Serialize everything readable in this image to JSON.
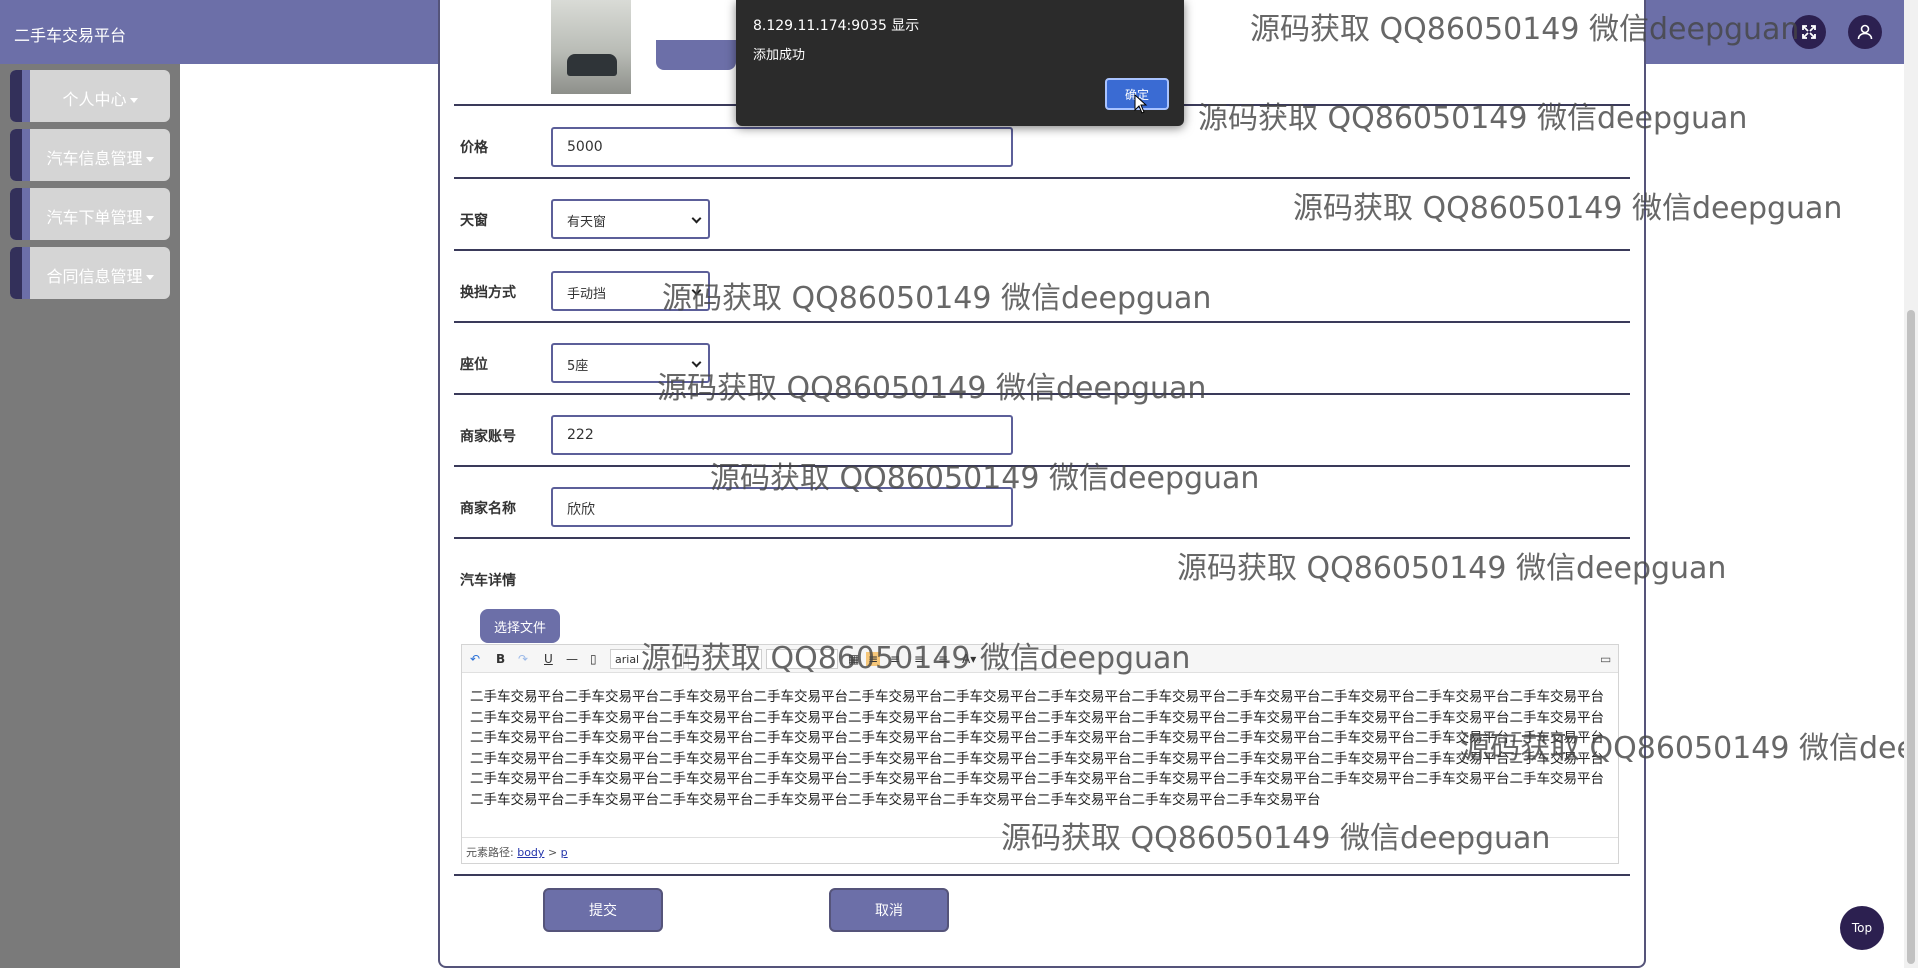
{
  "app": {
    "title": "二手车交易平台"
  },
  "header": {
    "fullscreen_icon": "expand-icon",
    "user_icon": "user-icon"
  },
  "sidebar": {
    "items": [
      {
        "label": "个人中心"
      },
      {
        "label": "汽车信息管理"
      },
      {
        "label": "汽车下单管理"
      },
      {
        "label": "合同信息管理"
      }
    ]
  },
  "form": {
    "price": {
      "label": "价格",
      "value": "5000"
    },
    "sunroof": {
      "label": "天窗",
      "value": "有天窗"
    },
    "transmission": {
      "label": "换挡方式",
      "value": "手动挡"
    },
    "seats": {
      "label": "座位",
      "value": "5座"
    },
    "merchant_account": {
      "label": "商家账号",
      "value": "222"
    },
    "merchant_name": {
      "label": "商家名称",
      "value": "欣欣"
    },
    "details": {
      "label": "汽车详情",
      "file_button": "选择文件"
    },
    "submit_label": "提交",
    "cancel_label": "取消"
  },
  "editor": {
    "font_family": "arial",
    "toolbar_bold": "B",
    "toolbar_underline": "U",
    "content": "二手车交易平台二手车交易平台二手车交易平台二手车交易平台二手车交易平台二手车交易平台二手车交易平台二手车交易平台二手车交易平台二手车交易平台二手车交易平台二手车交易平台二手车交易平台二手车交易平台二手车交易平台二手车交易平台二手车交易平台二手车交易平台二手车交易平台二手车交易平台二手车交易平台二手车交易平台二手车交易平台二手车交易平台二手车交易平台二手车交易平台二手车交易平台二手车交易平台二手车交易平台二手车交易平台二手车交易平台二手车交易平台二手车交易平台二手车交易平台二手车交易平台二手车交易平台二手车交易平台二手车交易平台二手车交易平台二手车交易平台二手车交易平台二手车交易平台二手车交易平台二手车交易平台二手车交易平台二手车交易平台二手车交易平台二手车交易平台二手车交易平台二手车交易平台二手车交易平台二手车交易平台二手车交易平台二手车交易平台二手车交易平台二手车交易平台二手车交易平台二手车交易平台二手车交易平台二手车交易平台二手车交易平台二手车交易平台二手车交易平台二手车交易平台二手车交易平台二手车交易平台二手车交易平台二手车交易平台二手车交易平台",
    "path_label": "元素路径:",
    "path_body": "body",
    "path_sep": ">",
    "path_p": "p"
  },
  "alert": {
    "origin": "8.129.11.174:9035 显示",
    "message": "添加成功",
    "ok_label": "确定"
  },
  "top_button": "Top",
  "watermark": "源码获取 QQ86050149 微信deepguan",
  "colors": {
    "accent": "#6c6fa8",
    "dark": "#2c2050",
    "sidebar_bg": "#7a7a7a"
  }
}
